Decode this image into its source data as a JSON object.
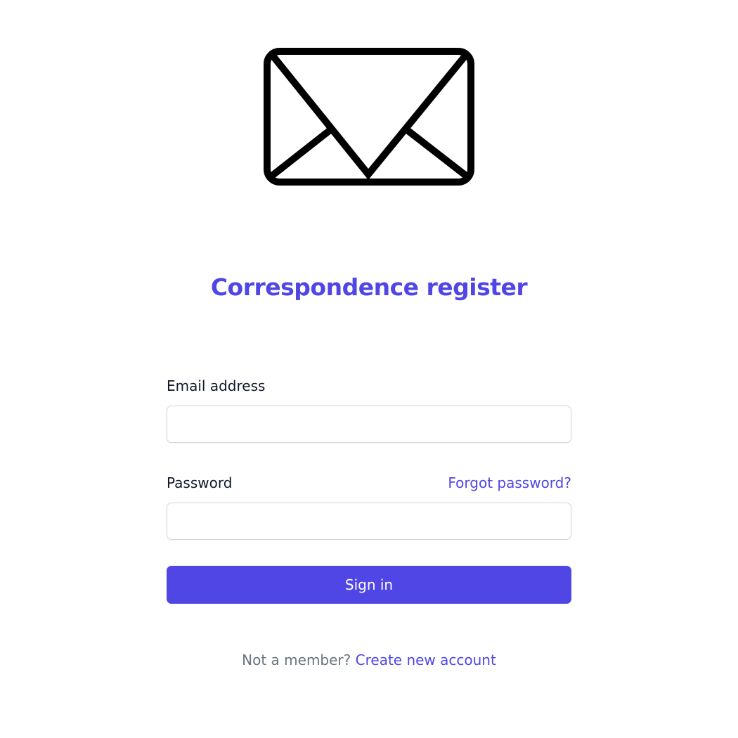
{
  "logo": {
    "icon": "envelope-icon"
  },
  "title": "Correspondence register",
  "form": {
    "email_label": "Email address",
    "email_value": "",
    "password_label": "Password",
    "password_value": "",
    "forgot_password": "Forgot password?",
    "signin_label": "Sign in"
  },
  "footer": {
    "prompt": "Not a member?",
    "link": "Create new account"
  },
  "colors": {
    "accent": "#4f46e5",
    "muted_text": "#6b7280",
    "input_border": "#d1d5db"
  }
}
